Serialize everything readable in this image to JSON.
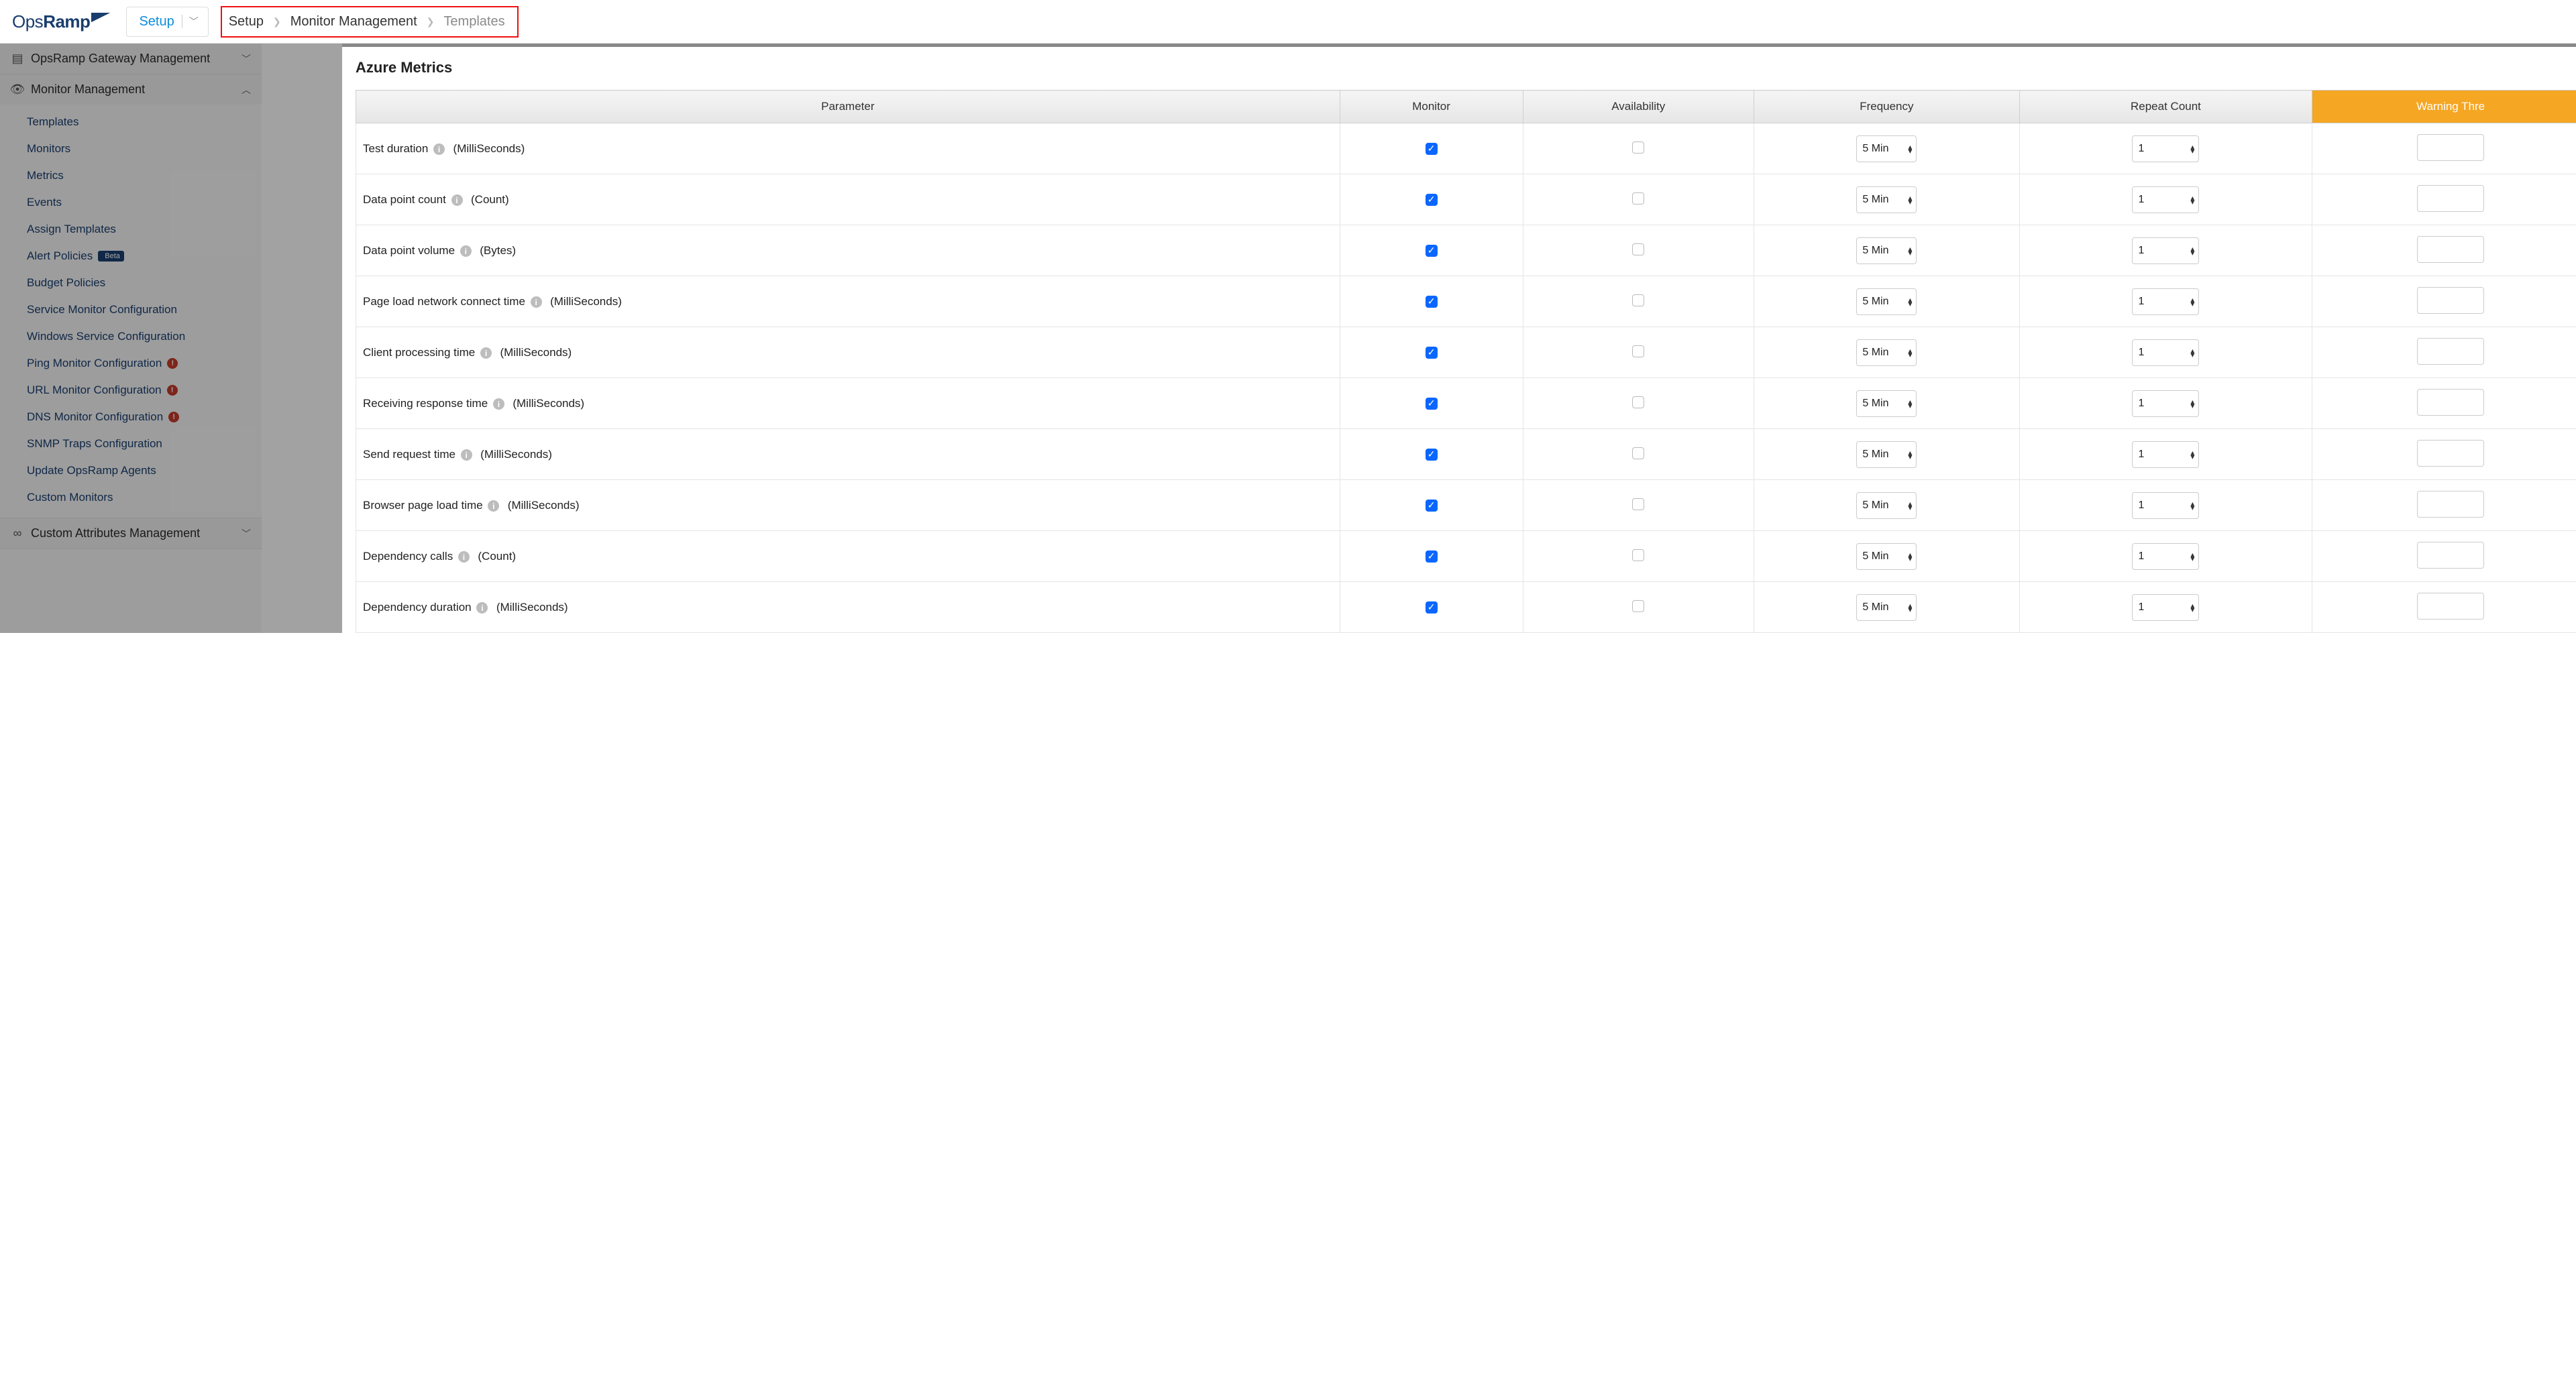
{
  "header": {
    "brand_prefix": "Ops",
    "brand_suffix": "Ramp",
    "setup_dropdown": "Setup",
    "breadcrumbs": [
      "Setup",
      "Monitor Management",
      "Templates"
    ]
  },
  "sidebar": {
    "groups": [
      {
        "icon": "chart-bar-icon",
        "label": "OpsRamp Gateway Management",
        "expanded": false,
        "items": []
      },
      {
        "icon": "eye-icon",
        "label": "Monitor Management",
        "expanded": true,
        "items": [
          {
            "label": "Templates"
          },
          {
            "label": "Monitors"
          },
          {
            "label": "Metrics"
          },
          {
            "label": "Events"
          },
          {
            "label": "Assign Templates"
          },
          {
            "label": "Alert Policies",
            "badge": "Beta"
          },
          {
            "label": "Budget Policies"
          },
          {
            "label": "Service Monitor Configuration"
          },
          {
            "label": "Windows Service Configuration"
          },
          {
            "label": "Ping Monitor Configuration",
            "alert": true
          },
          {
            "label": "URL Monitor Configuration",
            "alert": true
          },
          {
            "label": "DNS Monitor Configuration",
            "alert": true
          },
          {
            "label": "SNMP Traps Configuration"
          },
          {
            "label": "Update OpsRamp Agents"
          },
          {
            "label": "Custom Monitors"
          }
        ]
      },
      {
        "icon": "infinity-icon",
        "label": "Custom Attributes Management",
        "expanded": false,
        "items": []
      }
    ]
  },
  "main": {
    "title": "Azure Metrics",
    "columns": {
      "parameter": "Parameter",
      "monitor": "Monitor",
      "availability": "Availability",
      "frequency": "Frequency",
      "repeat_count": "Repeat Count",
      "warning_threshold": "Warning Thre"
    },
    "rows": [
      {
        "name": "Test duration",
        "unit": "(MilliSeconds)",
        "monitor": true,
        "availability": false,
        "frequency": "5 Min",
        "repeat": "1"
      },
      {
        "name": "Data point count",
        "unit": "(Count)",
        "monitor": true,
        "availability": false,
        "frequency": "5 Min",
        "repeat": "1"
      },
      {
        "name": "Data point volume",
        "unit": "(Bytes)",
        "monitor": true,
        "availability": false,
        "frequency": "5 Min",
        "repeat": "1"
      },
      {
        "name": "Page load network connect time",
        "unit": "(MilliSeconds)",
        "monitor": true,
        "availability": false,
        "frequency": "5 Min",
        "repeat": "1"
      },
      {
        "name": "Client processing time",
        "unit": "(MilliSeconds)",
        "monitor": true,
        "availability": false,
        "frequency": "5 Min",
        "repeat": "1"
      },
      {
        "name": "Receiving response time",
        "unit": "(MilliSeconds)",
        "monitor": true,
        "availability": false,
        "frequency": "5 Min",
        "repeat": "1"
      },
      {
        "name": "Send request time",
        "unit": "(MilliSeconds)",
        "monitor": true,
        "availability": false,
        "frequency": "5 Min",
        "repeat": "1"
      },
      {
        "name": "Browser page load time",
        "unit": "(MilliSeconds)",
        "monitor": true,
        "availability": false,
        "frequency": "5 Min",
        "repeat": "1"
      },
      {
        "name": "Dependency calls",
        "unit": "(Count)",
        "monitor": true,
        "availability": false,
        "frequency": "5 Min",
        "repeat": "1"
      },
      {
        "name": "Dependency duration",
        "unit": "(MilliSeconds)",
        "monitor": true,
        "availability": false,
        "frequency": "5 Min",
        "repeat": "1"
      }
    ]
  }
}
